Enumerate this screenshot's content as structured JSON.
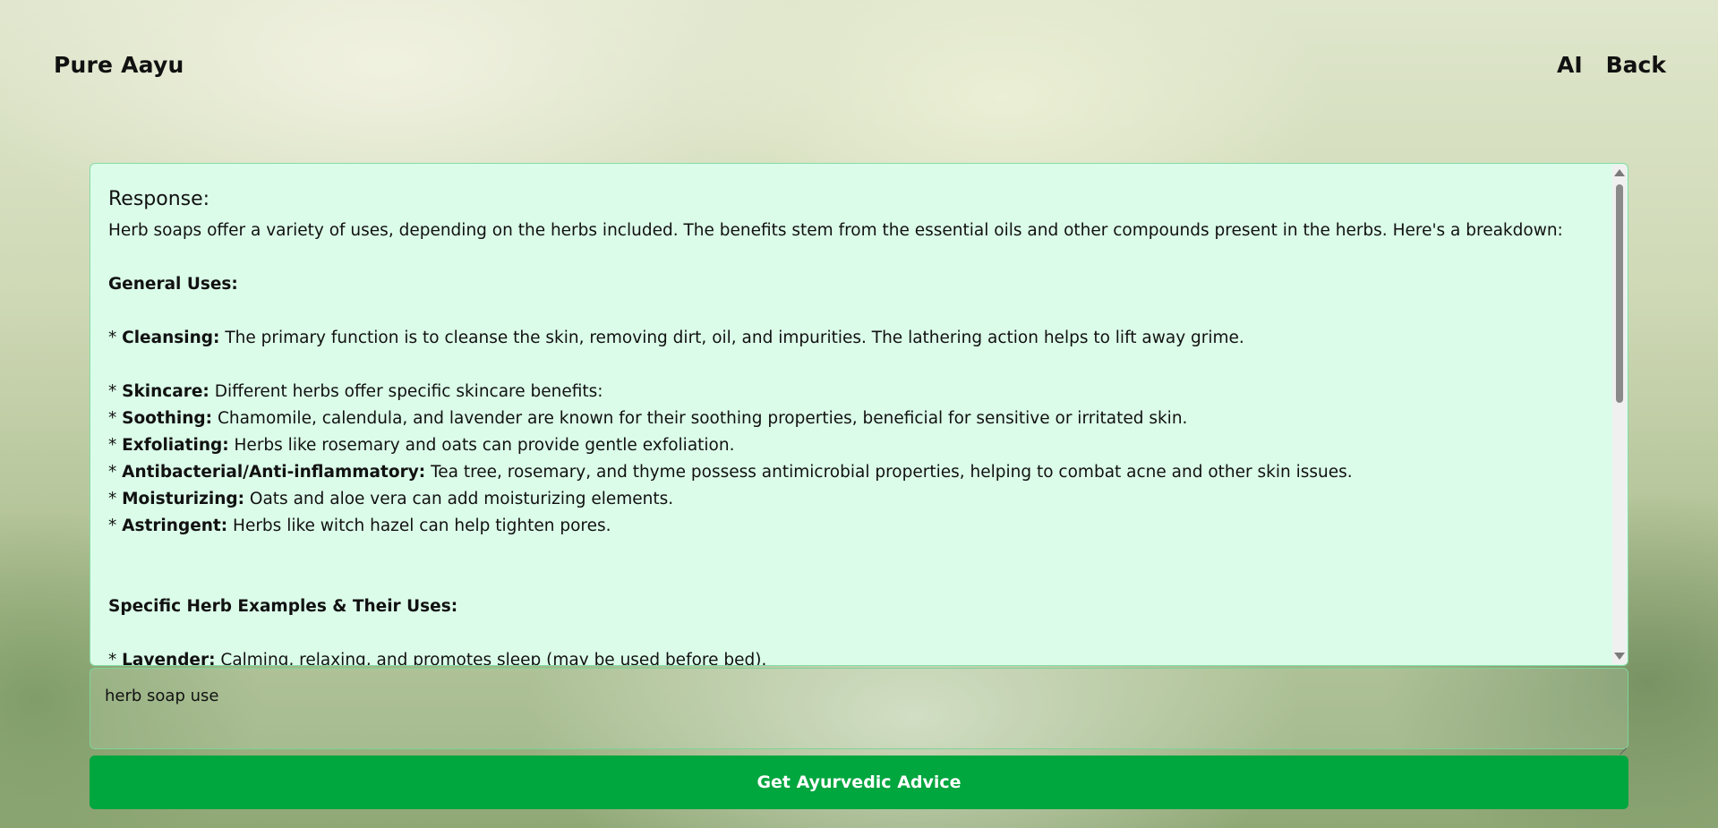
{
  "header": {
    "brand": "Pure Aayu",
    "nav": [
      {
        "label": "AI"
      },
      {
        "label": "Back"
      }
    ]
  },
  "response": {
    "heading": "Response:",
    "intro": "Herb soaps offer a variety of uses, depending on the herbs included. The benefits stem from the essential oils and other compounds present in the herbs. Here's a breakdown:",
    "general_heading": "General Uses:",
    "items": [
      {
        "prefix": "* ",
        "term": "Cleansing:",
        "text": " The primary function is to cleanse the skin, removing dirt, oil, and impurities. The lathering action helps to lift away grime."
      },
      {
        "prefix": "* ",
        "term": "Skincare:",
        "text": " Different herbs offer specific skincare benefits:"
      },
      {
        "prefix": "* ",
        "term": "Soothing:",
        "text": " Chamomile, calendula, and lavender are known for their soothing properties, beneficial for sensitive or irritated skin."
      },
      {
        "prefix": "* ",
        "term": "Exfoliating:",
        "text": " Herbs like rosemary and oats can provide gentle exfoliation."
      },
      {
        "prefix": "* ",
        "term": "Antibacterial/Anti-inflammatory:",
        "text": " Tea tree, rosemary, and thyme possess antimicrobial properties, helping to combat acne and other skin issues."
      },
      {
        "prefix": "* ",
        "term": "Moisturizing:",
        "text": " Oats and aloe vera can add moisturizing elements."
      },
      {
        "prefix": "* ",
        "term": "Astringent:",
        "text": " Herbs like witch hazel can help tighten pores."
      }
    ],
    "specific_heading": "Specific Herb Examples & Their Uses:",
    "specific_items": [
      {
        "prefix": "* ",
        "term": "Lavender:",
        "text": " Calming, relaxing, and promotes sleep (may be used before bed)."
      }
    ]
  },
  "query": {
    "value": "herb soap use"
  },
  "submit": {
    "label": "Get Ayurvedic Advice"
  },
  "colors": {
    "button": "#00a63e",
    "response_background": "#dbfce9",
    "border": "#86dca6"
  }
}
